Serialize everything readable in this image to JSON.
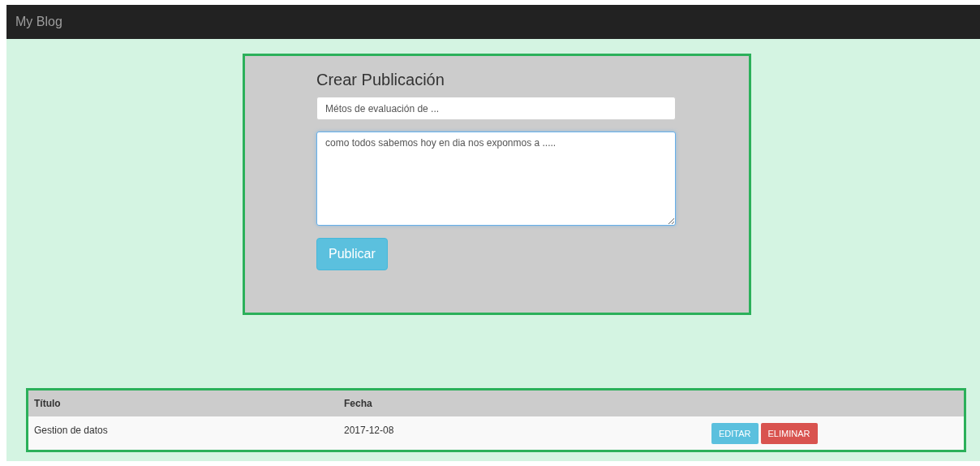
{
  "navbar": {
    "brand": "My Blog"
  },
  "form": {
    "heading": "Crear Publicación",
    "title_field": {
      "value": "Métos de evaluación de ..."
    },
    "body_field": {
      "value": "como todos sabemos hoy en dia nos exponmos a ....."
    },
    "submit": "Publicar"
  },
  "table": {
    "columns": [
      "Título",
      "Fecha"
    ],
    "rows": [
      {
        "cells": [
          "Gestion de datos",
          "2017-12-08"
        ],
        "actions": [
          {
            "kind": "edit",
            "label": "EDITAR"
          },
          {
            "kind": "delete",
            "label": "ELIMINAR"
          }
        ]
      }
    ]
  }
}
